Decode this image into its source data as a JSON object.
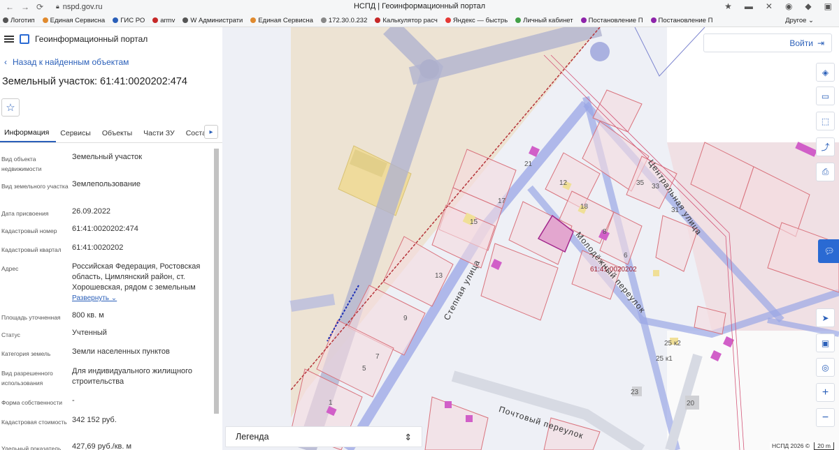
{
  "browser": {
    "url": "nspd.gov.ru",
    "window_title": "НСПД | Геоинформационный портал",
    "bookmarks": [
      {
        "label": "Логотип",
        "color": "#555555"
      },
      {
        "label": "Единая Сервисна",
        "color": "#e08a2e"
      },
      {
        "label": "ГИС РО",
        "color": "#2a5fb9"
      },
      {
        "label": "armv",
        "color": "#c62828"
      },
      {
        "label": "W Администрати",
        "color": "#555555"
      },
      {
        "label": "Единая Сервисна",
        "color": "#e08a2e"
      },
      {
        "label": "172.30.0.232",
        "color": "#888888"
      },
      {
        "label": "Калькулятор расч",
        "color": "#c62828"
      },
      {
        "label": "Яндекс — быстрь",
        "color": "#e53935"
      },
      {
        "label": "Личный кабинет",
        "color": "#43a047"
      },
      {
        "label": "Постановление П",
        "color": "#8e24aa"
      },
      {
        "label": "Постановление П",
        "color": "#8e24aa"
      }
    ],
    "other_bookmarks": "Другое"
  },
  "panel": {
    "portal_name": "Геоинформационный портал",
    "back_label": "Назад к найденным объектам",
    "object_title": "Земельный участок: 61:41:0020202:474",
    "tabs": [
      "Информация",
      "Сервисы",
      "Объекты",
      "Части ЗУ",
      "Состав"
    ],
    "properties": [
      {
        "label": "Вид объекта недвижимости",
        "value": "Земельный участок"
      },
      {
        "label": "Вид земельного участка",
        "value": "Землепользование"
      },
      {
        "label": "Дата присвоения",
        "value": "26.09.2022"
      },
      {
        "label": "Кадастровый номер",
        "value": "61:41:0020202:474"
      },
      {
        "label": "Кадастровый квартал",
        "value": "61:41:0020202"
      },
      {
        "label": "Адрес",
        "value": "Российская Федерация, Ростовская область, Цимлянский район, ст. Хорошевская, рядом с земельным"
      },
      {
        "label": "Площадь уточненная",
        "value": "800 кв. м"
      },
      {
        "label": "Статус",
        "value": "Учтенный"
      },
      {
        "label": "Категория земель",
        "value": "Земли населенных пунктов"
      },
      {
        "label": "Вид разрешенного использования",
        "value": "Для индивидуального жилищного строительства"
      },
      {
        "label": "Форма собственности",
        "value": "-"
      },
      {
        "label": "Кадастровая стоимость",
        "value": "342 152 руб."
      },
      {
        "label": "Удельный показатель",
        "value": "427,69 руб./кв. м"
      }
    ],
    "expand_label": "Развернуть"
  },
  "map": {
    "login_label": "Войти",
    "legend_label": "Легенда",
    "copyright": "НСПД 2026 ©",
    "scale": "20 m",
    "quarter_label": "61:41:0020202",
    "streets": [
      "Центральная улица",
      "Молодёжный переулок",
      "Степная улица",
      "Почтовый переулок"
    ],
    "house_numbers": [
      "21",
      "35",
      "12",
      "33",
      "17",
      "18",
      "31",
      "15",
      "8",
      "6",
      "13",
      "9",
      "7",
      "5",
      "1",
      "23",
      "25 к2",
      "25 к1",
      "20"
    ],
    "colors": {
      "parcel_border": "#d9737d",
      "parcel_fill": "#f5dbe0",
      "road": "#9aa6e6",
      "selected": "#a2278c"
    }
  }
}
